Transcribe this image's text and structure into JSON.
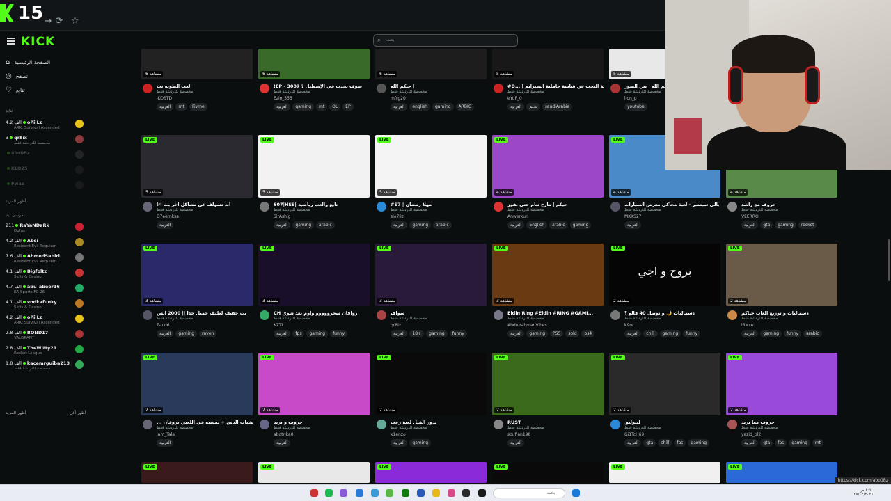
{
  "browser": {
    "badge_number": "15"
  },
  "sidebar": {
    "logo": "KICK",
    "nav": [
      {
        "label": "الصفحة الرئيسية",
        "icon": "home-icon"
      },
      {
        "label": "تصفح",
        "icon": "compass-icon"
      },
      {
        "label": "تتابع",
        "icon": "heart-icon"
      }
    ],
    "following_label": "تتابع",
    "following": [
      {
        "viewers": "4.2 الف",
        "name": "oPiiLz",
        "game": "ARK: Survival Ascended",
        "color": "#e8c21a",
        "dim": false
      },
      {
        "viewers": "3",
        "name": "qr8ix",
        "game": "مخصصة للدردشة فقط",
        "color": "#8a3a3a",
        "dim": false
      },
      {
        "viewers": "",
        "name": "abo0Bz",
        "game": "",
        "color": "#666",
        "dim": true
      },
      {
        "viewers": "",
        "name": "KLO25",
        "game": "",
        "color": "#444",
        "dim": true
      },
      {
        "viewers": "",
        "name": "Fwaz",
        "game": "",
        "color": "#444",
        "dim": true
      }
    ],
    "show_more_1": "أظهر المزيد",
    "recommended_label": "مرسى بيتا",
    "recommended": [
      {
        "viewers": "211",
        "name": "RaYaNDaRk",
        "game": "Dofus",
        "color": "#c23"
      },
      {
        "viewers": "4.2 الف",
        "name": "Absi",
        "game": "Resident Evil Requiem",
        "color": "#a82"
      },
      {
        "viewers": "7.6 الف",
        "name": "AhmedSabiri",
        "game": "Resident Evil Requiem",
        "color": "#777"
      },
      {
        "viewers": "4.1 الف",
        "name": "Bigfoltz",
        "game": "Slots & Casino",
        "color": "#c33"
      },
      {
        "viewers": "4.7 الف",
        "name": "abu_abeer16",
        "game": "EA Sports FC 26",
        "color": "#2a6"
      },
      {
        "viewers": "4.1 الف",
        "name": "vodkafunky",
        "game": "Slots & Casino",
        "color": "#b72"
      },
      {
        "viewers": "4.2 الف",
        "name": "oPiiLz",
        "game": "ARK: Survival Ascended",
        "color": "#e8c21a"
      },
      {
        "viewers": "2.8 الف",
        "name": "BOND17",
        "game": "VALORANT",
        "color": "#a33"
      },
      {
        "viewers": "2.8 الف",
        "name": "TheWitty21",
        "game": "Rocket League",
        "color": "#2a4"
      },
      {
        "viewers": "1.8 الف",
        "name": "kacemrguiba213",
        "game": "مخصصة للدردشة فقط",
        "color": "#3a5"
      }
    ],
    "show_more": "أظهر المزيد",
    "show_less": "أظهر أقل"
  },
  "search": {
    "placeholder": "بحث"
  },
  "live_label": "LIVE",
  "rows": [
    [
      {
        "viewers": "6 مشاهد",
        "title": "لعب الطويه بث",
        "cat": "مخصصة للدردشة فقط",
        "name": "iKOSTD",
        "tags": [
          "العربية",
          "rnt",
          "Fivme"
        ],
        "bg": "#222",
        "av": "#c22"
      },
      {
        "viewers": "6 مشاهد",
        "title": "!EP - 3007 ? سوف يحدث في الإسطبل",
        "cat": "مخصصة للدردشة فقط",
        "name": "Ezio_555",
        "tags": [
          "العربية",
          "gaming",
          "mt",
          "OL",
          "EP"
        ],
        "bg": "#3a6a2a",
        "av": "#d33"
      },
      {
        "viewers": "6 مشاهد",
        "title": "حيكم الله |",
        "cat": "مخصصة للدردشة فقط",
        "name": "mfrg20",
        "tags": [
          "العربية",
          "english",
          "gaming",
          "ARBIC"
        ],
        "bg": "#1d1d1d",
        "av": "#555"
      },
      {
        "viewers": "5 مشاهد",
        "title": "#D... | رحلة البحث عن شاشة جاهلية السترايم",
        "cat": "مخصصة للدردشة فقط",
        "name": "eYuF_0",
        "tags": [
          "العربية",
          "تختم",
          "saudiArabia"
        ],
        "bg": "#181818",
        "av": "#c22"
      },
      {
        "viewers": "5 مشاهد",
        "title": "حيكم الله | بين الصور",
        "cat": "مخصصة للدردشة فقط",
        "name": "lion_p",
        "tags": [
          "youtube"
        ],
        "bg": "#e8e8e8",
        "av": "#a33"
      }
    ],
    [
      {
        "viewers": "5 مشاهد",
        "title": "lrl أبد تسولف عن مشاكل أخر بث",
        "cat": "مخصصة للدردشة فقط",
        "name": "D7eemksa",
        "tags": [
          "العربية"
        ],
        "bg": "#2a2a30",
        "av": "#667"
      },
      {
        "viewers": "5 مشاهد",
        "title": "607|HSS| تابع والعب رياضيه",
        "cat": "مخصصة للدردشة فقط",
        "name": "SirAshig",
        "tags": [
          "العربية",
          "gaming",
          "arabic"
        ],
        "bg": "#f2f2f2",
        "av": "#777"
      },
      {
        "viewers": "5 مشاهد",
        "title": "#S7 | مهلا رمضان",
        "cat": "مخصصة للدردشة فقط",
        "name": "slo7iiz",
        "tags": [
          "العربية",
          "gaming",
          "arabic"
        ],
        "bg": "#f4f4f4",
        "av": "#2a8ad8"
      },
      {
        "viewers": "4 مشاهد",
        "title": "حيكم | مارح تنام حتى نفوز",
        "cat": "مخصصة للدردشة فقط",
        "name": "Anwerkun",
        "tags": [
          "العربية",
          "English",
          "arabic",
          "gaming"
        ],
        "bg": "#9a48c8",
        "av": "#d33"
      },
      {
        "viewers": "4 مشاهد",
        "title": "بالي سبتمبر - لعبة محاكي معرض السيارات",
        "cat": "مخصصة للدردشة فقط",
        "name": "MKKS27",
        "tags": [
          "العربية"
        ],
        "bg": "#4a8ac8",
        "av": "#556"
      },
      {
        "viewers": "4 مشاهد",
        "title": "حروف مع راشد",
        "cat": "مخصصة للدردشة فقط",
        "name": "VEERRO",
        "tags": [
          "العربية",
          "gta",
          "gaming",
          "rocket"
        ],
        "bg": "#5a8a4a",
        "av": "#888"
      }
    ],
    [
      {
        "viewers": "3 مشاهد",
        "title": "بث خفيف لطيف جميل جدا || 2000 انس",
        "cat": "مخصصة للدردشة فقط",
        "name": "Tsuki6",
        "tags": [
          "العربية",
          "gaming",
          "raven"
        ],
        "bg": "#2a2a6a",
        "av": "#556"
      },
      {
        "viewers": "3 مشاهد",
        "title": "CH رواقان سحرووووو واوم بعد شوي",
        "cat": "مخصصة للدردشة فقط",
        "name": "KZTL",
        "tags": [
          "العربية",
          "fps",
          "gaming",
          "funny"
        ],
        "bg": "#1a0f2a",
        "av": "#3a6"
      },
      {
        "viewers": "3 مشاهد",
        "title": "سواف",
        "cat": "مخصصة للدردشة فقط",
        "name": "qr8ix",
        "tags": [
          "العربية",
          "18+",
          "gaming",
          "funny"
        ],
        "bg": "#2a1a3a",
        "av": "#a44"
      },
      {
        "viewers": "3 مشاهد",
        "title": "Eldin Ring #Eldin #RING #GAMI...",
        "cat": "مخصصة للدردشة فقط",
        "name": "AbdulrahmanVibes",
        "tags": [
          "العربية",
          "gaming",
          "PS5",
          "solo",
          "ps4"
        ],
        "bg": "#6a3a12",
        "av": "#778"
      },
      {
        "viewers": "2 مشاهد",
        "title": "دسماليات 🌙 و نوصل 40 فالو ؟",
        "cat": "مخصصة للدردشة فقط",
        "name": "k9nr",
        "tags": [
          "العربية",
          "chill",
          "gaming",
          "funny"
        ],
        "bg": "#050505",
        "av": "#777",
        "overlay": "بروح و اجي"
      },
      {
        "viewers": "2 مشاهد",
        "title": "دسماليات و توزيع العاب حياكم",
        "cat": "مخصصة للدردشة فقط",
        "name": "i6wxe",
        "tags": [
          "العربية",
          "gaming",
          "funny",
          "arabic"
        ],
        "bg": "#6a5a48",
        "av": "#c84"
      }
    ],
    [
      {
        "viewers": "2 مشاهد",
        "title": "... مع الشباب الدس + تمشيه في اللعبي بروقان",
        "cat": "مخصصة للدردشة فقط",
        "name": "iam_Talal",
        "tags": [
          "العربية"
        ],
        "bg": "#2a3a5a",
        "av": "#667"
      },
      {
        "viewers": "2 مشاهد",
        "title": "حروف و يزيد",
        "cat": "مخصصة للدردشة فقط",
        "name": "abotrika0",
        "tags": [
          "العربية"
        ],
        "bg": "#c84ac8",
        "av": "#668"
      },
      {
        "viewers": "2 مشاهد",
        "title": "تدور القتل لعبة رعب",
        "cat": "مخصصة للدردشة فقط",
        "name": "x1enzo",
        "tags": [
          "العربية",
          "gaming"
        ],
        "bg": "#0a0a0a",
        "av": "#6a9"
      },
      {
        "viewers": "2 مشاهد",
        "title": "RUST",
        "cat": "مخصصة للدردشة فقط",
        "name": "soufian198",
        "tags": [
          "العربية"
        ],
        "bg": "#3a6a1a",
        "av": "#888"
      },
      {
        "viewers": "2 مشاهد",
        "title": "ليتوليق",
        "cat": "مخصصة للدردشة فقط",
        "name": "Gi1TcH69",
        "tags": [
          "العربية",
          "gta",
          "chill",
          "fps",
          "gaming"
        ],
        "bg": "#2a2a2a",
        "av": "#2a8ad8"
      },
      {
        "viewers": "2 مشاهد",
        "title": "حروف معا يزيد",
        "cat": "مخصصة للدردشة فقط",
        "name": "yazid_bl2",
        "tags": [
          "العربية",
          "gta",
          "fps",
          "gaming",
          "mt"
        ],
        "bg": "#9a4ad8",
        "av": "#a55"
      }
    ]
  ],
  "status_url": "https://kick.com/abo0Bz",
  "taskbar": {
    "search": "بحث",
    "time": "٨:٥١ ص",
    "date": "٢٧/٠٢/٢٠٢٦"
  }
}
